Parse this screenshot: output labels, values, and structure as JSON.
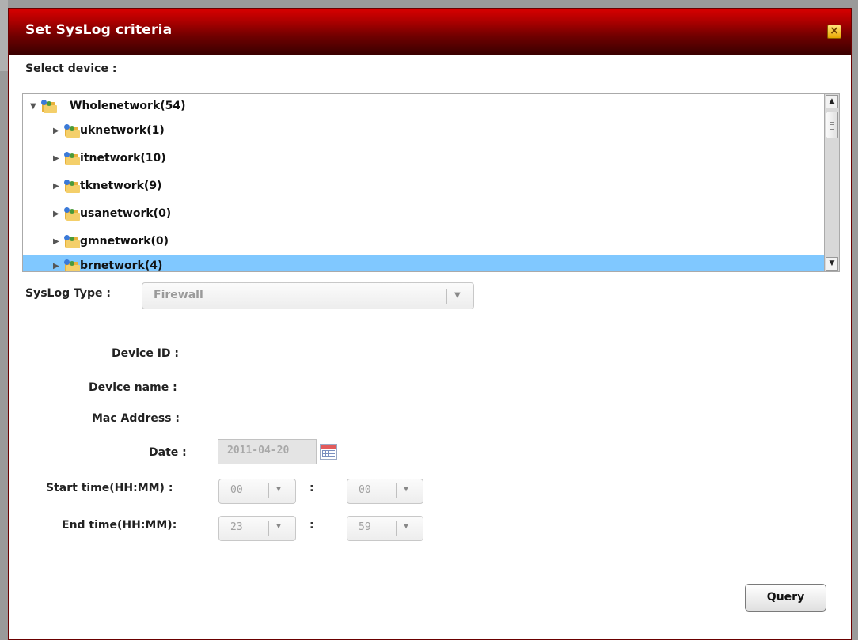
{
  "dialog": {
    "title": "Set SysLog criteria",
    "close_symbol": "×"
  },
  "select_device_label": "Select device :",
  "tree": {
    "root": {
      "label": "Wholenetwork(54)",
      "expanded": true,
      "icon": "network-folder-icon"
    },
    "children": [
      {
        "label": "uknetwork(1)",
        "selected": false
      },
      {
        "label": "itnetwork(10)",
        "selected": false
      },
      {
        "label": "tknetwork(9)",
        "selected": false
      },
      {
        "label": "usanetwork(0)",
        "selected": false
      },
      {
        "label": "gmnetwork(0)",
        "selected": false
      },
      {
        "label": "brnetwork(4)",
        "selected": true
      }
    ],
    "selected_color": "#80c8ff"
  },
  "syslog_type": {
    "label": "SysLog Type :",
    "value": "Firewall"
  },
  "fields": {
    "device_id_label": "Device ID :",
    "device_name_label": "Device name :",
    "mac_address_label": "Mac Address :",
    "date_label": "Date :",
    "date_value": "2011-04-20",
    "start_time_label": "Start time(HH:MM) :",
    "start_hour": "00",
    "start_minute": "00",
    "end_time_label": "End time(HH:MM):",
    "end_hour": "23",
    "end_minute": "59",
    "time_separator": ":"
  },
  "query_button": "Query",
  "colors": {
    "titlebar_top": "#d80000",
    "titlebar_bottom": "#380000",
    "close_button": "#e8a800"
  }
}
